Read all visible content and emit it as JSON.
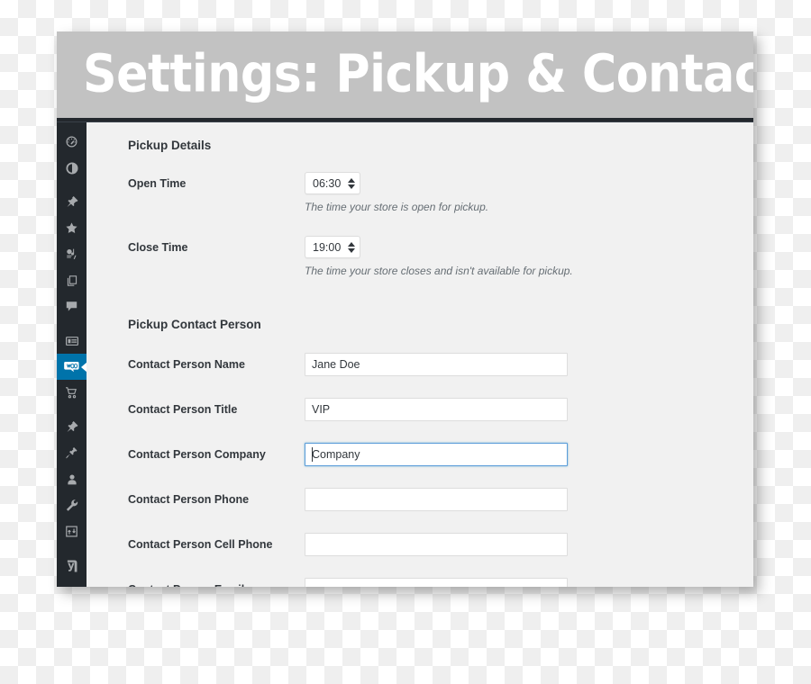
{
  "window": {
    "title": "Settings: Pickup & Contact",
    "title_bar_color": "#c2c2c2",
    "title_text_color": "#ffffff",
    "content_bg": "#f1f1f1",
    "rule_color": "#23282d"
  },
  "sidebar": {
    "bg_color": "#23282d",
    "active_color": "#0073aa",
    "icon_color": "#a7aaad",
    "items": [
      {
        "name": "dashboard-icon",
        "label": "Dashboard"
      },
      {
        "name": "updates-icon",
        "label": "Updates"
      },
      {
        "name": "pin-icon",
        "label": "Posts"
      },
      {
        "name": "star-icon",
        "label": "Favorites"
      },
      {
        "name": "media-icon",
        "label": "Media"
      },
      {
        "name": "pages-icon",
        "label": "Pages"
      },
      {
        "name": "comments-icon",
        "label": "Comments"
      },
      {
        "name": "forms-icon",
        "label": "Forms"
      },
      {
        "name": "woocommerce-icon",
        "label": "WooCommerce",
        "active": true
      },
      {
        "name": "cart-icon",
        "label": "Products"
      },
      {
        "name": "pin-alt-icon",
        "label": "Marketing"
      },
      {
        "name": "plugin-icon",
        "label": "Plugins"
      },
      {
        "name": "user-icon",
        "label": "Users"
      },
      {
        "name": "wrench-icon",
        "label": "Tools"
      },
      {
        "name": "analytics-icon",
        "label": "Analytics"
      },
      {
        "name": "yoast-icon",
        "label": "Yoast SEO"
      }
    ]
  },
  "content": {
    "sections": [
      {
        "heading": "Pickup Details"
      },
      {
        "heading": "Pickup Contact Person"
      }
    ],
    "pickup_details": {
      "heading": "Pickup Details",
      "open_time": {
        "label": "Open Time",
        "value": "06:30",
        "help": "The time your store is open for pickup."
      },
      "close_time": {
        "label": "Close Time",
        "value": "19:00",
        "help": "The time your store closes and isn't available for pickup."
      }
    },
    "pickup_contact": {
      "heading": "Pickup Contact Person",
      "fields": [
        {
          "label": "Contact Person Name",
          "value": "Jane Doe",
          "placeholder": "",
          "focused": false
        },
        {
          "label": "Contact Person Title",
          "value": "VIP",
          "placeholder": "",
          "focused": false
        },
        {
          "label": "Contact Person Company",
          "value": "Company",
          "placeholder": "",
          "focused": true
        },
        {
          "label": "Contact Person Phone",
          "value": "",
          "placeholder": "",
          "focused": false
        },
        {
          "label": "Contact Person Cell Phone",
          "value": "",
          "placeholder": "",
          "focused": false
        },
        {
          "label": "Contact Person Email",
          "value": "",
          "placeholder": "",
          "focused": false
        }
      ]
    }
  }
}
